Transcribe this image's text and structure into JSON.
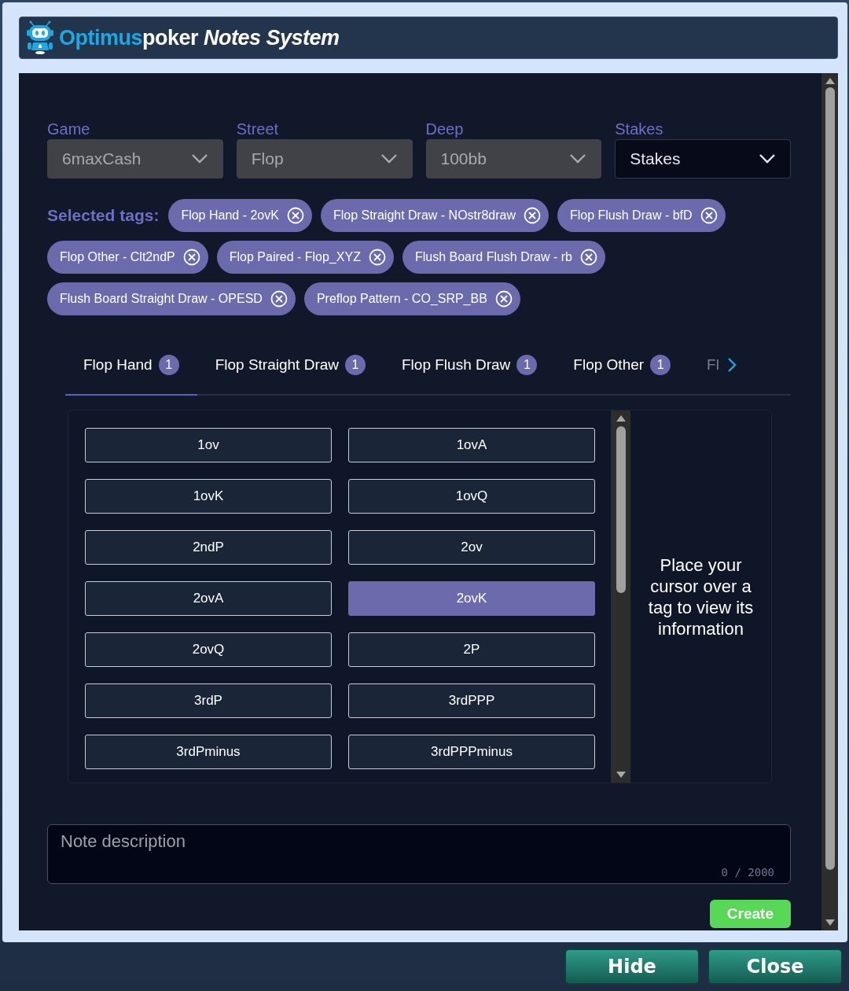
{
  "window": {
    "brand_first": "Optimus",
    "brand_second": "poker",
    "title": "Notes System"
  },
  "filters": [
    {
      "label": "Game",
      "value": "6maxCash",
      "disabled": true
    },
    {
      "label": "Street",
      "value": "Flop",
      "disabled": true
    },
    {
      "label": "Deep",
      "value": "100bb",
      "disabled": true
    },
    {
      "label": "Stakes",
      "value": "Stakes",
      "disabled": false
    }
  ],
  "selected_tags": {
    "label": "Selected tags:",
    "tags": [
      "Flop Hand - 2ovK",
      "Flop Straight Draw - NOstr8draw",
      "Flop Flush Draw - bfD",
      "Flop Other - Clt2ndP",
      "Flop Paired - Flop_XYZ",
      "Flush Board Flush Draw - rb",
      "Flush Board Straight Draw - OPESD",
      "Preflop Pattern - CO_SRP_BB"
    ]
  },
  "tabs": [
    {
      "label": "Flop Hand",
      "count": "1",
      "selected": true
    },
    {
      "label": "Flop Straight Draw",
      "count": "1",
      "selected": false
    },
    {
      "label": "Flop Flush Draw",
      "count": "1",
      "selected": false
    },
    {
      "label": "Flop Other",
      "count": "1",
      "selected": false
    },
    {
      "label": "Fl",
      "selected": false
    }
  ],
  "tag_buttons": [
    {
      "label": "1ov",
      "selected": false
    },
    {
      "label": "1ovA",
      "selected": false
    },
    {
      "label": "1ovK",
      "selected": false
    },
    {
      "label": "1ovQ",
      "selected": false
    },
    {
      "label": "2ndP",
      "selected": false
    },
    {
      "label": "2ov",
      "selected": false
    },
    {
      "label": "2ovA",
      "selected": false
    },
    {
      "label": "2ovK",
      "selected": true
    },
    {
      "label": "2ovQ",
      "selected": false
    },
    {
      "label": "2P",
      "selected": false
    },
    {
      "label": "3rdP",
      "selected": false
    },
    {
      "label": "3rdPPP",
      "selected": false
    },
    {
      "label": "3rdPminus",
      "selected": false
    },
    {
      "label": "3rdPPPminus",
      "selected": false
    }
  ],
  "info_text": "Place your cursor over a tag to view its information",
  "note": {
    "placeholder": "Note description",
    "counter": "0 / 2000"
  },
  "create_button": "Create",
  "footer_buttons": [
    "Hide",
    "Close"
  ]
}
